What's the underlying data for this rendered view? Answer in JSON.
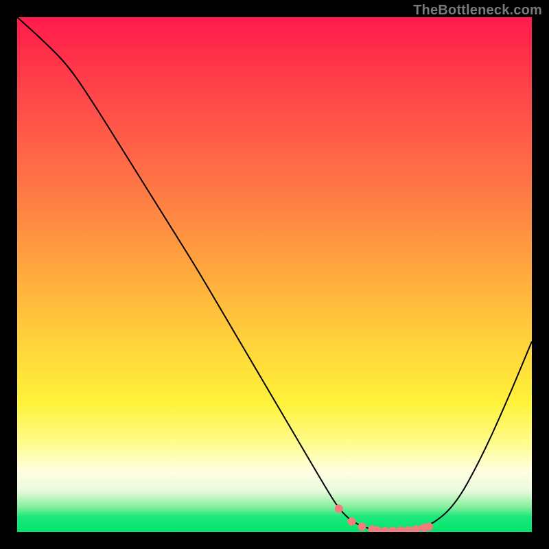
{
  "watermark": "TheBottleneck.com",
  "chart_data": {
    "type": "line",
    "title": "",
    "xlabel": "",
    "ylabel": "",
    "xlim": [
      0,
      1
    ],
    "ylim": [
      0,
      1
    ],
    "x": [
      0.0,
      0.05,
      0.1,
      0.15,
      0.2,
      0.25,
      0.3,
      0.35,
      0.4,
      0.45,
      0.5,
      0.55,
      0.6,
      0.625,
      0.65,
      0.68,
      0.7,
      0.73,
      0.76,
      0.8,
      0.85,
      0.9,
      0.95,
      1.0
    ],
    "values": [
      1.0,
      0.955,
      0.905,
      0.83,
      0.75,
      0.67,
      0.59,
      0.51,
      0.425,
      0.34,
      0.255,
      0.17,
      0.085,
      0.045,
      0.02,
      0.007,
      0.003,
      0.002,
      0.003,
      0.01,
      0.05,
      0.14,
      0.25,
      0.37
    ],
    "markers_x": [
      0.625,
      0.65,
      0.67,
      0.69,
      0.7,
      0.715,
      0.73,
      0.745,
      0.76,
      0.775,
      0.79,
      0.8
    ],
    "markers_y": [
      0.045,
      0.02,
      0.01,
      0.005,
      0.003,
      0.002,
      0.002,
      0.003,
      0.003,
      0.005,
      0.008,
      0.01
    ],
    "gradient_stops": [
      {
        "pos": 0.0,
        "color": "#ff1a4b"
      },
      {
        "pos": 0.12,
        "color": "#ff3e4a"
      },
      {
        "pos": 0.3,
        "color": "#ff6e47"
      },
      {
        "pos": 0.48,
        "color": "#ffa43f"
      },
      {
        "pos": 0.63,
        "color": "#ffd23a"
      },
      {
        "pos": 0.75,
        "color": "#fff23a"
      },
      {
        "pos": 0.83,
        "color": "#fffc8f"
      },
      {
        "pos": 0.88,
        "color": "#ffffe0"
      },
      {
        "pos": 0.92,
        "color": "#eafadf"
      },
      {
        "pos": 0.95,
        "color": "#8bf0a0"
      },
      {
        "pos": 0.97,
        "color": "#1fe87d"
      },
      {
        "pos": 1.0,
        "color": "#00e56e"
      }
    ]
  }
}
